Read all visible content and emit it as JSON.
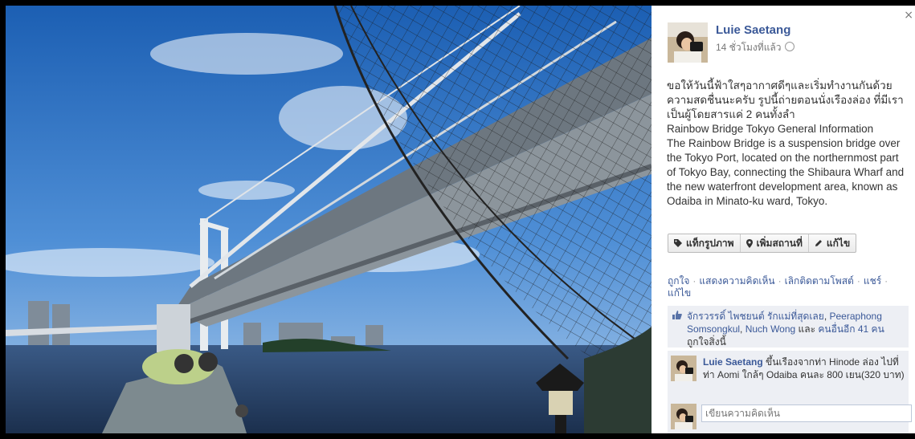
{
  "photo": {
    "description_icon": "bridge-photo"
  },
  "post": {
    "author": "Luie Saetang",
    "time": "14 ชั่วโมงที่แล้ว",
    "caption": "ขอให้วันนี้ฟ้าใสๆอากาศดีๆและเริ่มทำงานกันด้วยความสดชื่นนะครับ รูปนี้ถ่ายตอนนั่งเรืองล่อง ที่มีเราเป็นผู้โดยสารแค่ 2 คนทั้งลำ\nRainbow Bridge Tokyo General Information\nThe Rainbow Bridge is a suspension bridge over the Tokyo Port, located on the northernmost part of Tokyo Bay, connecting the Shibaura Wharf and the new waterfront development area, known as Odaiba in Minato-ku ward, Tokyo."
  },
  "actions": {
    "tag": "แท็กรูปภาพ",
    "location": "เพิ่มสถานที่",
    "edit": "แก้ไข"
  },
  "links": {
    "like": "ถูกใจ",
    "comment": "แสดงความคิดเห็น",
    "unfollow": "เลิกติดตามโพสต์",
    "share": "แชร์",
    "edit": "แก้ไข"
  },
  "likes": {
    "name1": "จักรวรรดิ์ ไพชยนต์ รักแม่ที่สุดเลย",
    "sep1": ", ",
    "name2": "Peeraphong Somsongkul",
    "sep2": ", ",
    "name3": "Nuch Wong",
    "and": " และ ",
    "others": "คนอื่นอีก 41 คน",
    "suffix": " ถูกใจสิ่งนี้"
  },
  "comment": {
    "author": "Luie Saetang",
    "text": " ขึ้นเรืองจากท่า Hinode ล่อง ไปที่ท่า Aomi ใกล้ๆ Odaiba คนละ 800 เยน(320 บาท)"
  },
  "write_comment": {
    "placeholder": "เขียนความคิดเห็น"
  },
  "close": "×",
  "colors": {
    "link": "#3b5998",
    "panel_bg": "#ffffff",
    "like_bg": "#edeff4"
  }
}
